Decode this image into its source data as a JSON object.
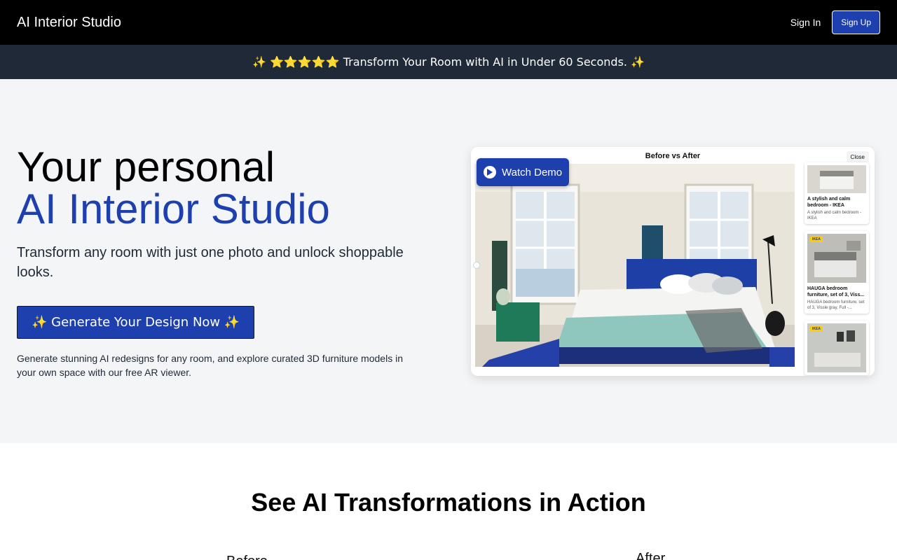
{
  "nav": {
    "brand": "AI Interior Studio",
    "signin_label": "Sign In",
    "signup_label": "Sign Up"
  },
  "banner": {
    "text": "✨ ⭐⭐⭐⭐⭐ Transform Your Room with AI in Under 60 Seconds. ✨"
  },
  "hero": {
    "title_line1": "Your personal",
    "title_line2": "AI Interior Studio",
    "subtitle": "Transform any room with just one photo and unlock shoppable looks.",
    "cta_label": "✨ Generate Your Design Now ✨",
    "description": "Generate stunning AI redesigns for any room, and explore curated 3D furniture models in your own space with our free AR viewer."
  },
  "demo": {
    "title": "Before vs After",
    "close_label": "Close",
    "watch_label": "Watch Demo",
    "products": [
      {
        "name": "A stylish and calm bedroom - IKEA",
        "desc": "A stylish and calm bedroom - IKEA",
        "tag": ""
      },
      {
        "name": "HAUGA bedroom furniture, set of 3, Viss...",
        "desc": "HAUGA bedroom furniture, set of 3, Vissle gray, Full -...",
        "tag": "IKEA"
      },
      {
        "name": "",
        "desc": "",
        "tag": "IKEA"
      }
    ]
  },
  "section": {
    "title": "See AI Transformations in Action",
    "before_label": "Before",
    "after_label": "After"
  },
  "colors": {
    "accent": "#1e40af",
    "topbar": "#000000",
    "banner": "#1f2937",
    "hero_bg": "#f3f5f7"
  },
  "icons": {
    "play": "play-icon"
  }
}
